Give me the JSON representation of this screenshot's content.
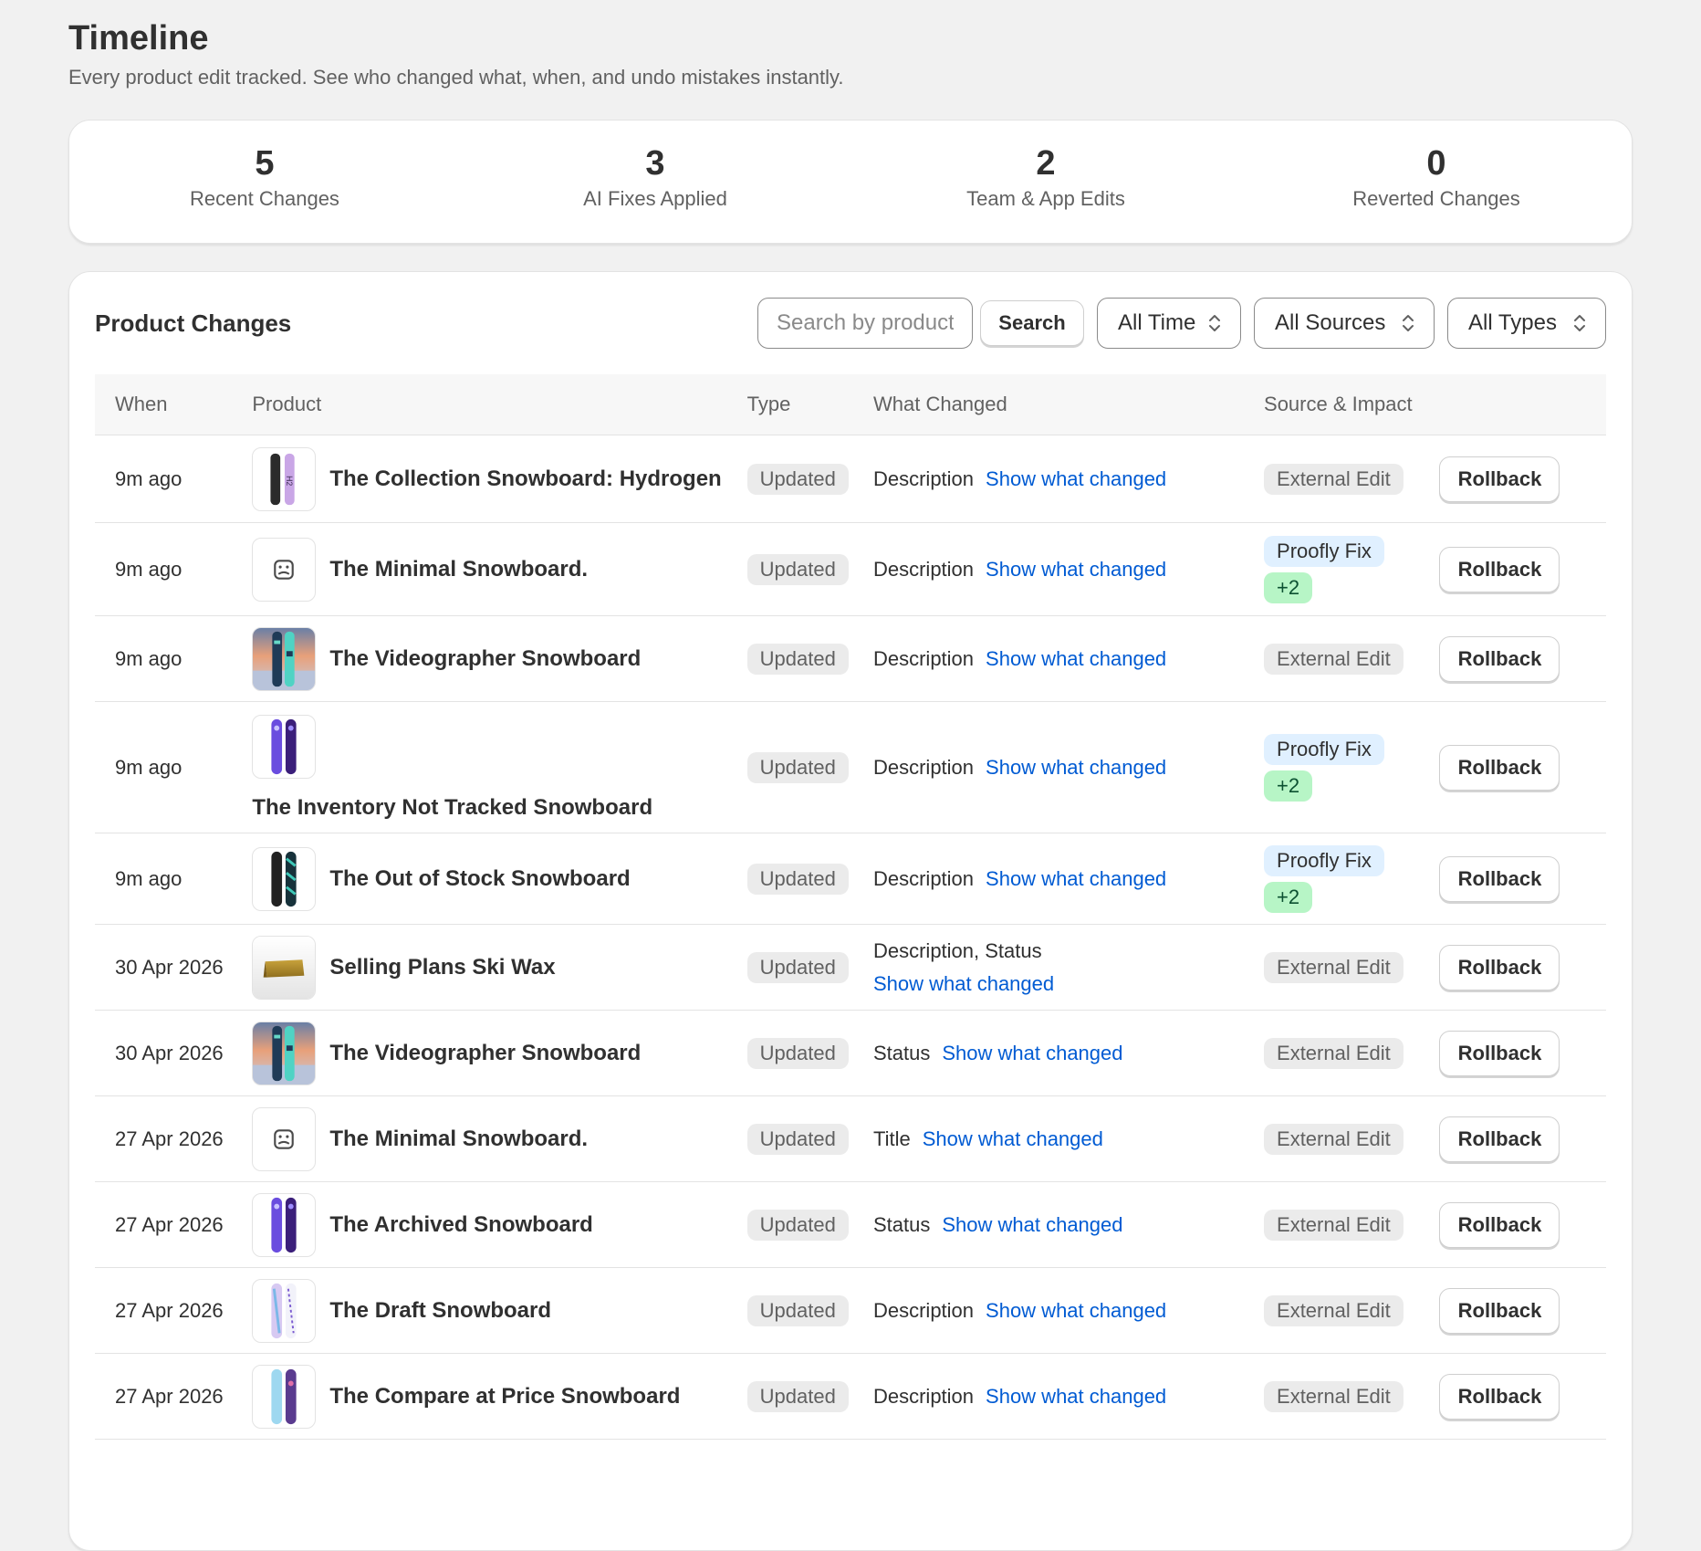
{
  "header": {
    "title": "Timeline",
    "subtitle": "Every product edit tracked. See who changed what, when, and undo mistakes instantly."
  },
  "stats": [
    {
      "value": "5",
      "label": "Recent Changes"
    },
    {
      "value": "3",
      "label": "AI Fixes Applied"
    },
    {
      "value": "2",
      "label": "Team & App Edits"
    },
    {
      "value": "0",
      "label": "Reverted Changes"
    }
  ],
  "changes": {
    "title": "Product Changes",
    "search_placeholder": "Search by product",
    "search_button": "Search",
    "filters": {
      "time": "All Time",
      "sources": "All Sources",
      "types": "All Types"
    },
    "columns": {
      "when": "When",
      "product": "Product",
      "type": "Type",
      "what_changed": "What Changed",
      "source": "Source & Impact"
    },
    "link_label": "Show what changed",
    "rollback_label": "Rollback",
    "rows": [
      {
        "when": "9m ago",
        "product": "The Collection Snowboard: Hydrogen",
        "thumb": "board-hydrogen",
        "type": "Updated",
        "changed": "Description",
        "source": "External Edit",
        "extra": ""
      },
      {
        "when": "9m ago",
        "product": "The Minimal Snowboard.",
        "thumb": "placeholder-image-icon",
        "type": "Updated",
        "changed": "Description",
        "source": "Proofly Fix",
        "extra": "+2"
      },
      {
        "when": "9m ago",
        "product": "The Videographer Snowboard",
        "thumb": "board-videographer",
        "type": "Updated",
        "changed": "Description",
        "source": "External Edit",
        "extra": ""
      },
      {
        "when": "9m ago",
        "product": "The Inventory Not Tracked Snowboard",
        "thumb": "board-purple",
        "type": "Updated",
        "changed": "Description",
        "source": "Proofly Fix",
        "extra": "+2"
      },
      {
        "when": "9m ago",
        "product": "The Out of Stock Snowboard",
        "thumb": "board-dark",
        "type": "Updated",
        "changed": "Description",
        "source": "Proofly Fix",
        "extra": "+2"
      },
      {
        "when": "30 Apr 2026",
        "product": "Selling Plans Ski Wax",
        "thumb": "ski-wax",
        "type": "Updated",
        "changed": "Description, Status",
        "source": "External Edit",
        "extra": ""
      },
      {
        "when": "30 Apr 2026",
        "product": "The Videographer Snowboard",
        "thumb": "board-videographer",
        "type": "Updated",
        "changed": "Status",
        "source": "External Edit",
        "extra": ""
      },
      {
        "when": "27 Apr 2026",
        "product": "The Minimal Snowboard.",
        "thumb": "placeholder-image-icon",
        "type": "Updated",
        "changed": "Title",
        "source": "External Edit",
        "extra": ""
      },
      {
        "when": "27 Apr 2026",
        "product": "The Archived Snowboard",
        "thumb": "board-purple",
        "type": "Updated",
        "changed": "Status",
        "source": "External Edit",
        "extra": ""
      },
      {
        "when": "27 Apr 2026",
        "product": "The Draft Snowboard",
        "thumb": "board-draft",
        "type": "Updated",
        "changed": "Description",
        "source": "External Edit",
        "extra": ""
      },
      {
        "when": "27 Apr 2026",
        "product": "The Compare at Price Snowboard",
        "thumb": "board-compare",
        "type": "Updated",
        "changed": "Description",
        "source": "External Edit",
        "extra": ""
      }
    ]
  },
  "colors": {
    "link": "#005bd3",
    "badge_blue": "#e0f0ff",
    "badge_green": "#b7f5c6",
    "badge_grey": "#ebebeb"
  }
}
